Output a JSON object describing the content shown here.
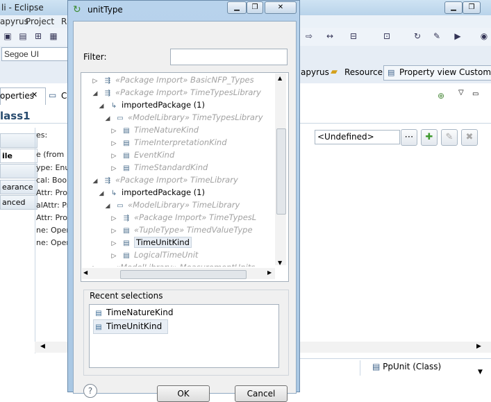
{
  "background": {
    "window_title": "li - Eclipse",
    "menu": [
      "apyrus",
      "Project",
      "R"
    ],
    "font_combo": "Segoe UI",
    "properties_tab": "operties",
    "second_tab": "C",
    "class_title": "lass1",
    "left_tabs": [
      "ile",
      "earance",
      "anced"
    ],
    "left_lines": [
      "es:",
      "e   (from",
      "ype: Enur",
      "cal: Bool",
      "Attr: Prop",
      "alAttr: Pro",
      "Attr: Prop",
      "ne: Opera",
      "ne: Opera"
    ],
    "editor_tabs": [
      "apyrus",
      "Resource",
      "Property view Customiza"
    ],
    "undefined_value": "<Undefined>",
    "status_item": "PpUnit (Class)"
  },
  "dialog": {
    "title": "unitType",
    "filter_label": "Filter:",
    "filter_value": "",
    "tree": [
      {
        "text": "«Package Import» BasicNFP_Types",
        "gray": true,
        "arrow": "▷",
        "icon": "pkgimp",
        "indent": 2
      },
      {
        "text": "«Package Import» TimeTypesLibrary",
        "gray": true,
        "arrow": "◢",
        "icon": "pkgimp",
        "indent": 2
      },
      {
        "text": "importedPackage (1)",
        "gray": false,
        "arrow": "◢",
        "icon": "ref",
        "indent": 3
      },
      {
        "text": "«ModelLibrary» TimeTypesLibrary",
        "gray": true,
        "arrow": "◢",
        "icon": "folder",
        "indent": 4
      },
      {
        "text": "TimeNatureKind",
        "gray": true,
        "arrow": "▷",
        "icon": "enum",
        "indent": 5
      },
      {
        "text": "TimeInterpretationKind",
        "gray": true,
        "arrow": "▷",
        "icon": "enum",
        "indent": 5
      },
      {
        "text": "EventKind",
        "gray": true,
        "arrow": "▷",
        "icon": "enum",
        "indent": 5
      },
      {
        "text": "TimeStandardKind",
        "gray": true,
        "arrow": "▷",
        "icon": "enum",
        "indent": 5
      },
      {
        "text": "«Package Import» TimeLibrary",
        "gray": true,
        "arrow": "◢",
        "icon": "pkgimp",
        "indent": 2
      },
      {
        "text": "importedPackage (1)",
        "gray": false,
        "arrow": "◢",
        "icon": "ref",
        "indent": 3
      },
      {
        "text": "«ModelLibrary» TimeLibrary",
        "gray": true,
        "arrow": "◢",
        "icon": "folder",
        "indent": 4
      },
      {
        "text": "«Package Import» TimeTypesL",
        "gray": true,
        "arrow": "▷",
        "icon": "pkgimp",
        "indent": 5
      },
      {
        "text": "«TupleType» TimedValueType",
        "gray": true,
        "arrow": "▷",
        "icon": "enum",
        "indent": 5
      },
      {
        "text": "TimeUnitKind",
        "gray": false,
        "arrow": "▷",
        "icon": "enum",
        "indent": 5,
        "selected": true
      },
      {
        "text": "LogicalTimeUnit",
        "gray": true,
        "arrow": "▷",
        "icon": "enum",
        "indent": 5
      },
      {
        "text": "«ModelLibrary» MeasurementUnits",
        "gray": true,
        "arrow": "▷",
        "icon": "folder",
        "indent": 2
      }
    ],
    "recent_label": "Recent selections",
    "recent": [
      "TimeNatureKind",
      "TimeUnitKind"
    ],
    "help": "?",
    "ok_label": "OK",
    "cancel_label": "Cancel"
  }
}
